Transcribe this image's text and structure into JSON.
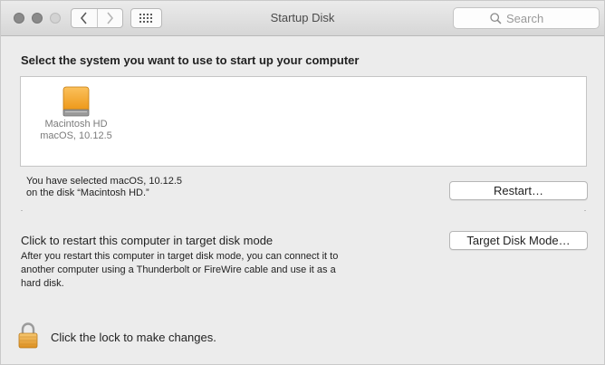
{
  "window": {
    "title": "Startup Disk"
  },
  "search": {
    "placeholder": "Search"
  },
  "main": {
    "heading": "Select the system you want to use to start up your computer",
    "disks": [
      {
        "name": "Macintosh HD",
        "os": "macOS, 10.12.5"
      }
    ],
    "selected_line1": "You have selected macOS, 10.12.5",
    "selected_line2": "on the disk “Macintosh HD.”",
    "restart_label": "Restart…",
    "target_title": "Click to restart this computer in target disk mode",
    "target_desc_line1": "After you restart this computer in target disk mode, you can connect it to",
    "target_desc_line2": "another computer using a Thunderbolt or FireWire cable and use it as a",
    "target_desc_line3": "hard disk.",
    "target_button_label": "Target Disk Mode…"
  },
  "footer": {
    "lock_text": "Click the lock to make changes."
  },
  "icons": {
    "back": "chevron-left-icon",
    "forward": "chevron-right-icon",
    "show_all": "grid-icon",
    "search": "magnifier-icon",
    "disk": "hard-disk-icon",
    "lock": "lock-icon"
  },
  "colors": {
    "disk_orange": "#f5a623",
    "lock_gold": "#e8a73a"
  }
}
